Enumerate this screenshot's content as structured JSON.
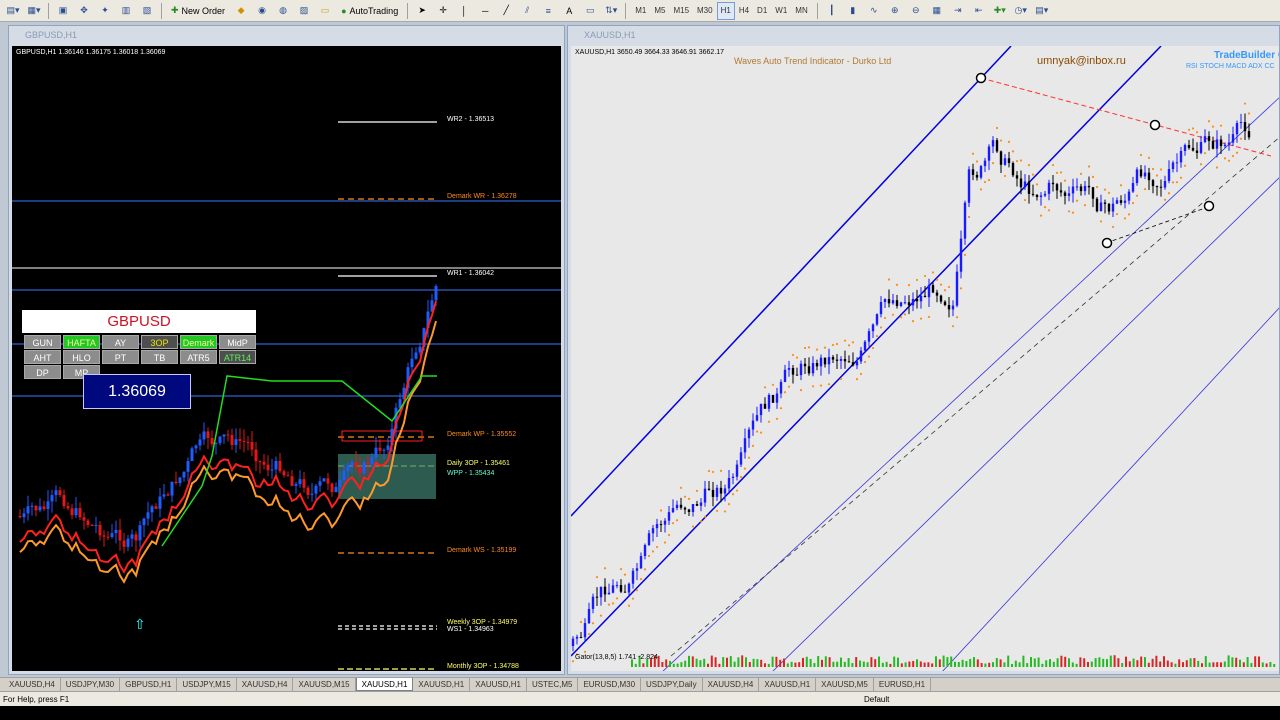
{
  "toolbar": {
    "new_order": "New Order",
    "autotrading": "AutoTrading",
    "timeframes": [
      "M1",
      "M5",
      "M15",
      "M30",
      "H1",
      "H4",
      "D1",
      "W1",
      "MN"
    ],
    "active_timeframe": "H1"
  },
  "left_window": {
    "title": "GBPUSD,H1",
    "ohlc": "GBPUSD,H1  1.36146 1.36175 1.36018 1.36069",
    "levels": {
      "wr2": "WR2 - 1.36513",
      "demark_wr": "Demark WR - 1.36278",
      "wr1": "WR1 - 1.36042",
      "demark_wp": "Demark WP - 1.35552",
      "daily_3op": "Daily 3OP - 1.35461",
      "wpp": "WPP - 1.35434",
      "demark_ws": "Demark WS - 1.35199",
      "weekly_3op": "Weekly 3OP - 1.34979",
      "ws1": "WS1 - 1.34963",
      "monthly_3op": "Monthly 3OP - 1.34788"
    },
    "panel": {
      "symbol": "GBPUSD",
      "buttons": [
        "GUN",
        "HAFTA",
        "AY",
        "3OP",
        "Demark",
        "MidP",
        "AHT",
        "HLO",
        "PT",
        "TB",
        "ATR5",
        "ATR14",
        "DP",
        "MP"
      ],
      "price": "1.36069"
    }
  },
  "right_window": {
    "title": "XAUUSD,H1",
    "ohlc": "XAUUSD,H1  3650.49 3664.33 3646.91 3662.17",
    "indicator_label": "Waves Auto Trend Indicator - Durko Ltd",
    "email": "umnyak@inbox.ru",
    "tradebuilder": "TradeBuilder C",
    "tradebuilder_sub": "RSI  STOCH  MACD  ADX  CC",
    "gator_label": "Gator(13,8,5) 1.741 -2.824"
  },
  "tabs": [
    "XAUUSD,H4",
    "USDJPY,M30",
    "GBPUSD,H1",
    "USDJPY,M15",
    "XAUUSD,H4",
    "XAUUSD,M15",
    "XAUUSD,H1",
    "XAUUSD,H1",
    "XAUUSD,H1",
    "USTEC,M5",
    "EURUSD,M30",
    "USDJPY,Daily",
    "XAUUSD,H4",
    "XAUUSD,H1",
    "XAUUSD,M5",
    "EURUSD,H1"
  ],
  "active_tab": "XAUUSD,H1",
  "status": {
    "help": "For Help, press F1",
    "profile": "Default"
  },
  "colors": {
    "bull_candle": "#1e5cff",
    "bear_candle": "#e01818",
    "level_orange": "#ff8c1a",
    "channel_blue": "#0000e0",
    "green_line": "#22dd22",
    "panel_title_red": "#d01020"
  }
}
